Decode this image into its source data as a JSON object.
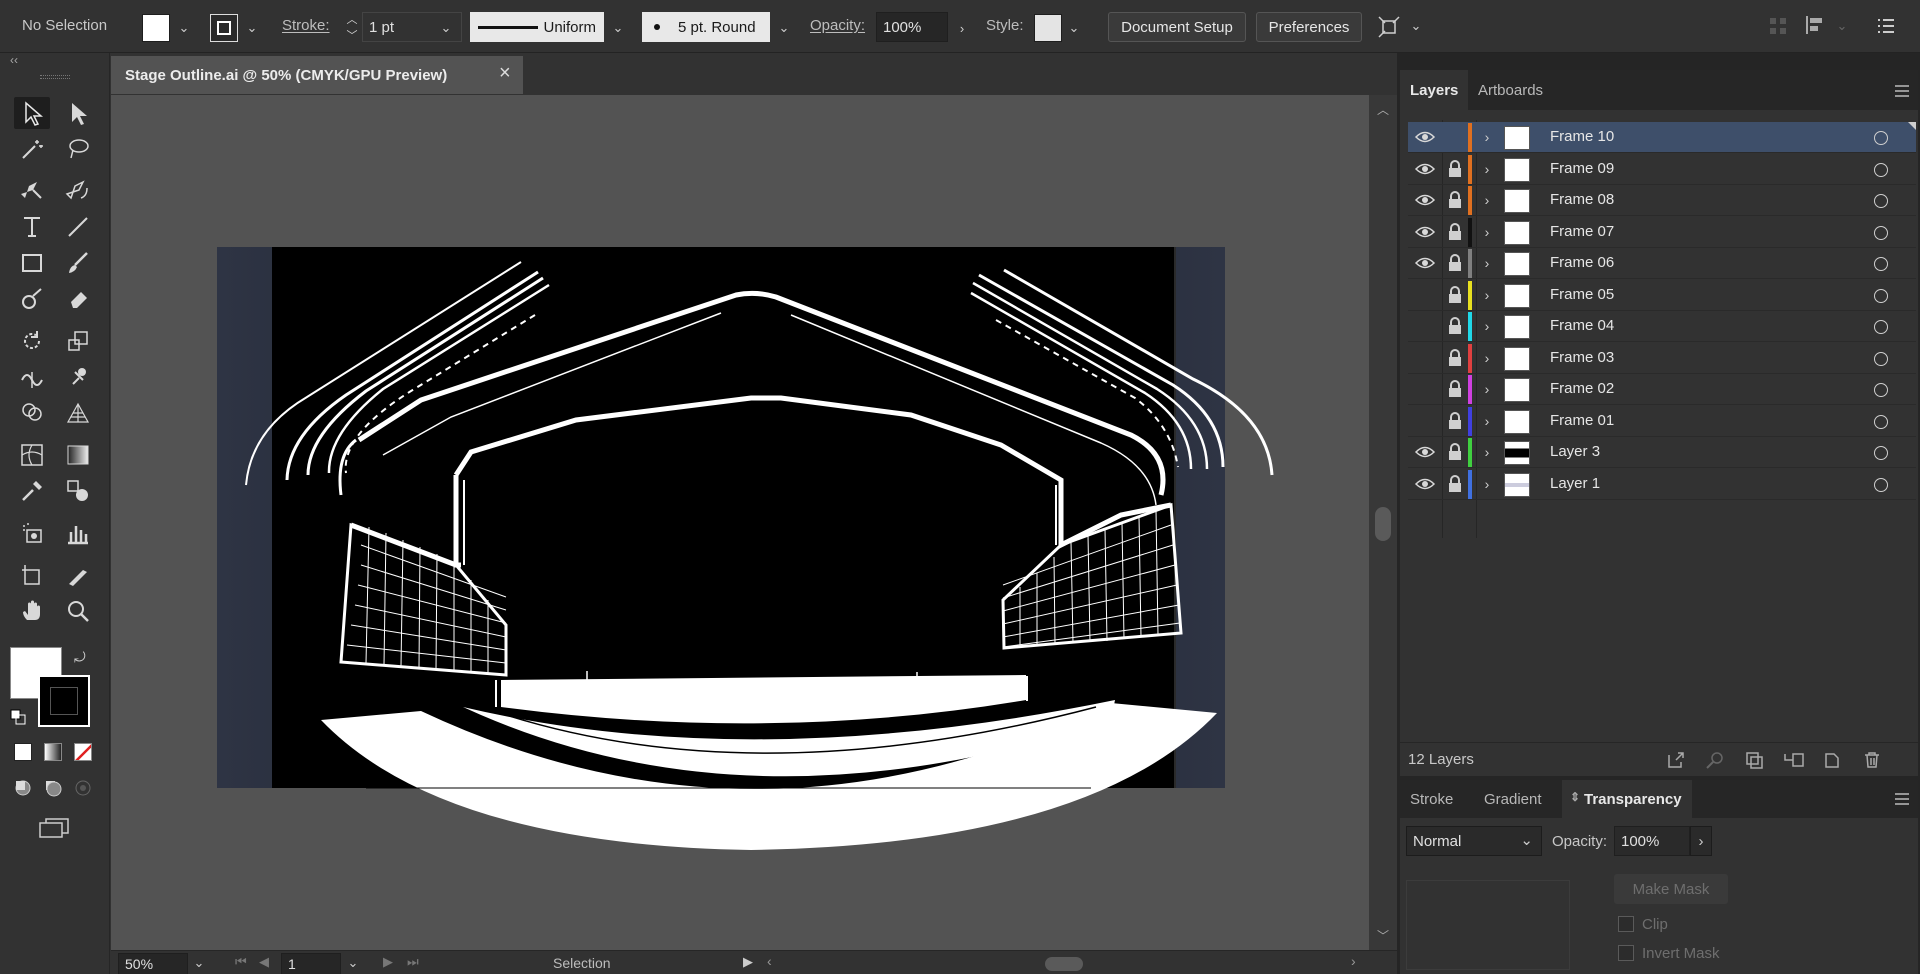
{
  "control_bar": {
    "selection_label": "No Selection",
    "stroke_label": "Stroke:",
    "stroke_weight": "1 pt",
    "profile_label": "Uniform",
    "brush_label": "5 pt. Round",
    "opacity_label": "Opacity:",
    "opacity_value": "100%",
    "style_label": "Style:",
    "document_setup": "Document Setup",
    "preferences": "Preferences"
  },
  "document": {
    "tab_title": "Stage Outline.ai @ 50% (CMYK/GPU Preview)",
    "close_glyph": "×"
  },
  "status_bar": {
    "zoom": "50%",
    "artboard": "1",
    "tool": "Selection"
  },
  "layers_panel": {
    "tabs": [
      "Layers",
      "Artboards"
    ],
    "layers": [
      {
        "name": "Frame 10",
        "visible": true,
        "locked": false,
        "color": "#e07020",
        "selected": true
      },
      {
        "name": "Frame 09",
        "visible": true,
        "locked": true,
        "color": "#e07020",
        "selected": false
      },
      {
        "name": "Frame 08",
        "visible": true,
        "locked": true,
        "color": "#e07020",
        "selected": false
      },
      {
        "name": "Frame 07",
        "visible": true,
        "locked": true,
        "color": "#111111",
        "selected": false
      },
      {
        "name": "Frame 06",
        "visible": true,
        "locked": true,
        "color": "#808080",
        "selected": false
      },
      {
        "name": "Frame 05",
        "visible": false,
        "locked": true,
        "color": "#e8e020",
        "selected": false
      },
      {
        "name": "Frame 04",
        "visible": false,
        "locked": true,
        "color": "#20d8e8",
        "selected": false
      },
      {
        "name": "Frame 03",
        "visible": false,
        "locked": true,
        "color": "#e04040",
        "selected": false
      },
      {
        "name": "Frame 02",
        "visible": false,
        "locked": true,
        "color": "#d040e0",
        "selected": false
      },
      {
        "name": "Frame 01",
        "visible": false,
        "locked": true,
        "color": "#4040e0",
        "selected": false
      },
      {
        "name": "Layer 3",
        "visible": true,
        "locked": true,
        "color": "#40d040",
        "selected": false
      },
      {
        "name": "Layer 1",
        "visible": true,
        "locked": true,
        "color": "#4070e0",
        "selected": false
      }
    ],
    "count_label": "12 Layers"
  },
  "transparency_panel": {
    "tabs": [
      "Stroke",
      "Gradient",
      "Transparency"
    ],
    "blend_mode": "Normal",
    "opacity_label": "Opacity:",
    "opacity_value": "100%",
    "make_mask": "Make Mask",
    "clip_label": "Clip",
    "invert_mask_label": "Invert Mask"
  }
}
